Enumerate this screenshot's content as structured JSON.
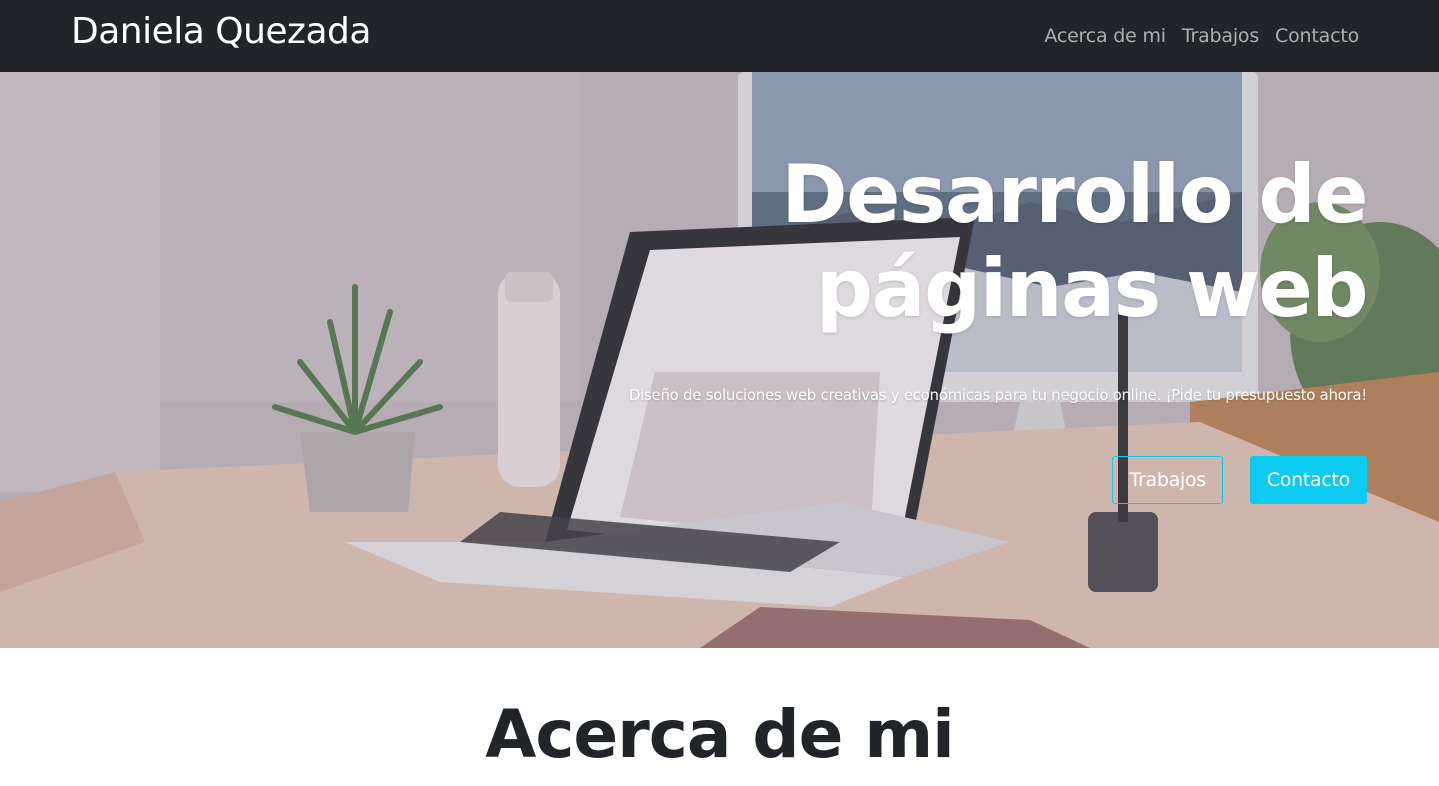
{
  "navbar": {
    "brand": "Daniela Quezada",
    "links": [
      {
        "label": "Acerca de mi"
      },
      {
        "label": "Trabajos"
      },
      {
        "label": "Contacto"
      }
    ],
    "background": "#212529"
  },
  "hero": {
    "title_line1": "Desarrollo de",
    "title_line2": "páginas web",
    "lead": "Diseño de soluciones web creativas y económicas para tu negocio online. ¡Pide tu presupuesto ahora!",
    "buttons": {
      "primary_outline_label": "Trabajos",
      "primary_solid_label": "Contacto"
    },
    "accent": "#0dcaf0",
    "background_image": "desk-with-laptop-and-monitor"
  },
  "about": {
    "title": "Acerca de mi"
  }
}
